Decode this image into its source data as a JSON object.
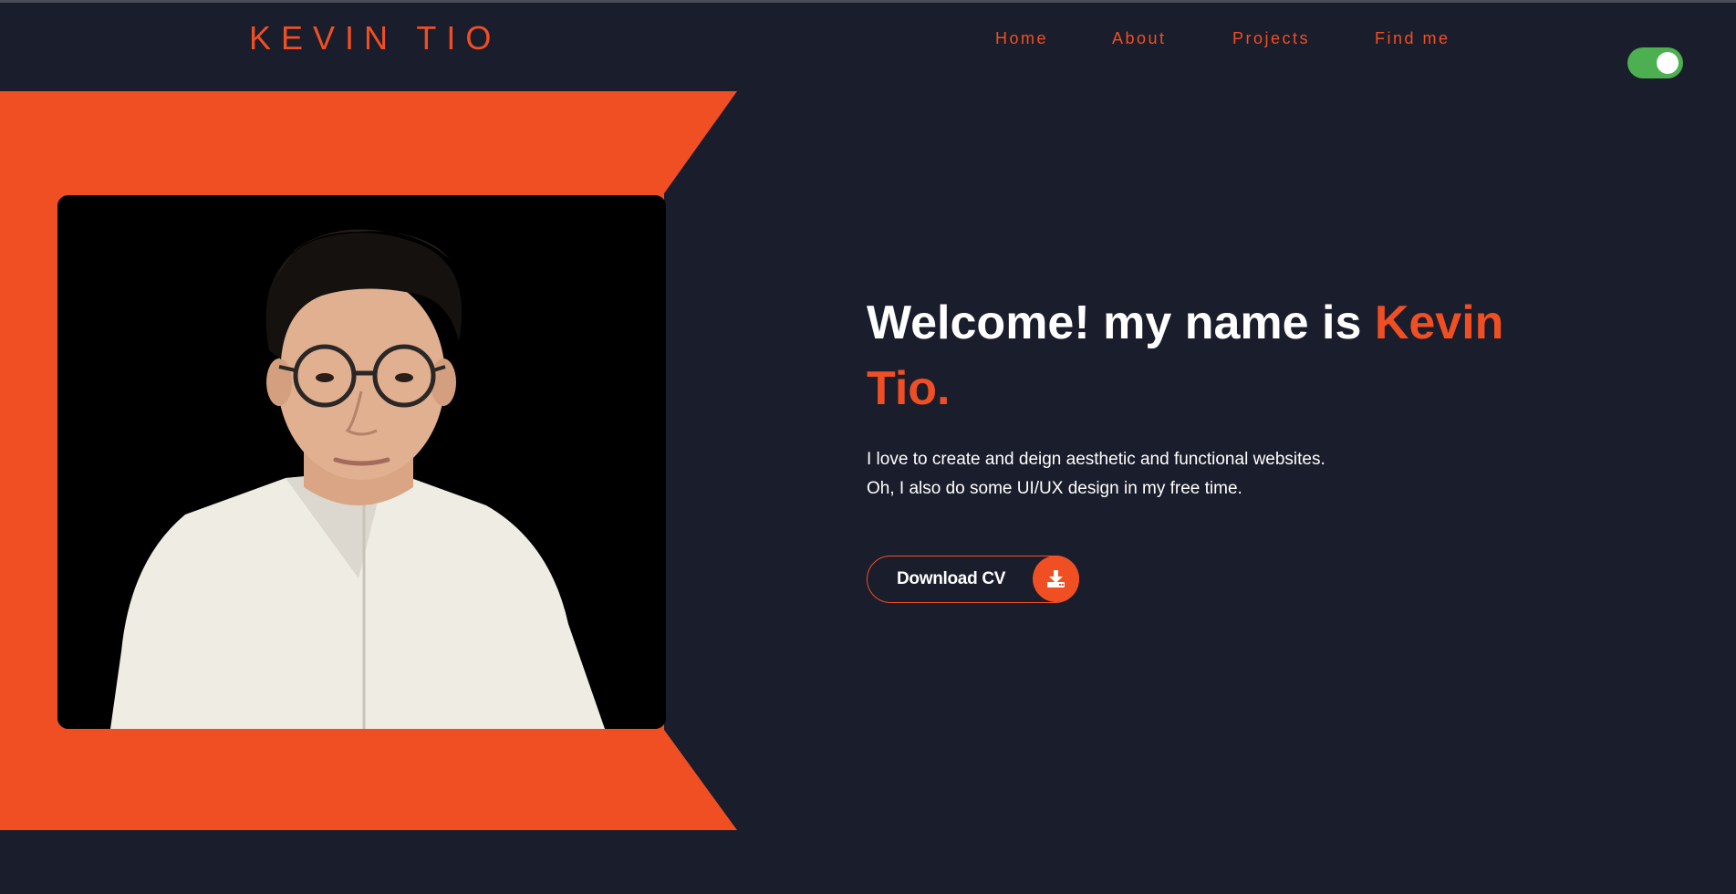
{
  "header": {
    "logo": "KEVIN TIO",
    "nav": [
      {
        "label": "Home"
      },
      {
        "label": "About"
      },
      {
        "label": "Projects"
      },
      {
        "label": "Find me"
      }
    ],
    "theme_toggle": {
      "state": "on",
      "color": "#4caf50"
    }
  },
  "hero": {
    "heading_prefix": "Welcome! my name is ",
    "heading_name": "Kevin Tio.",
    "intro_lines": [
      "I love to create and deign aesthetic and functional websites.",
      "Oh, I also do some UI/UX design in my free time."
    ],
    "cv_button": {
      "label": "Download CV",
      "icon": "download-icon"
    },
    "photo": {
      "icon": "portrait-photo"
    }
  },
  "colors": {
    "background": "#1a1d2b",
    "accent": "#f04f23",
    "text": "#ffffff"
  }
}
